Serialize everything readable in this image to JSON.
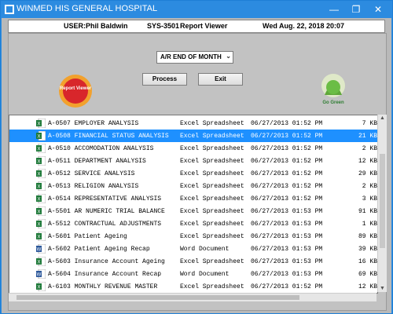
{
  "window": {
    "title": "WINMED HIS GENERAL HOSPITAL",
    "minimize": "—",
    "maximize": "❐",
    "close": "✕"
  },
  "userbar": {
    "user": "USER:Phil Baldwin",
    "system": "SYS-3501",
    "module": "Report Viewer",
    "datetime": "Wed Aug. 22, 2018 20:07"
  },
  "controls": {
    "report_select": "A/R END OF MONTH",
    "process_label": "Process",
    "exit_label": "Exit"
  },
  "logos": {
    "report_viewer": "Report Viewer",
    "go_green": "Go Green"
  },
  "files": [
    {
      "code": "A-0507",
      "name": "EMPLOYER ANALYSIS",
      "type": "Excel Spreadsheet",
      "date": "06/27/2013 01:52 PM",
      "size": "7 KB",
      "icon": "excel-icon",
      "selected": false
    },
    {
      "code": "A-0508",
      "name": "FINANCIAL STATUS ANALYSIS",
      "type": "Excel Spreadsheet",
      "date": "06/27/2013 01:52 PM",
      "size": "21 KB",
      "icon": "excel-icon",
      "selected": true
    },
    {
      "code": "A-0510",
      "name": "ACCOMODATION ANALYSIS",
      "type": "Excel Spreadsheet",
      "date": "06/27/2013 01:52 PM",
      "size": "2 KB",
      "icon": "excel-icon",
      "selected": false
    },
    {
      "code": "A-0511",
      "name": "DEPARTMENT ANALYSIS",
      "type": "Excel Spreadsheet",
      "date": "06/27/2013 01:52 PM",
      "size": "12 KB",
      "icon": "excel-icon",
      "selected": false
    },
    {
      "code": "A-0512",
      "name": "SERVICE ANALYSIS",
      "type": "Excel Spreadsheet",
      "date": "06/27/2013 01:52 PM",
      "size": "29 KB",
      "icon": "excel-icon",
      "selected": false
    },
    {
      "code": "A-0513",
      "name": "RELIGION ANALYSIS",
      "type": "Excel Spreadsheet",
      "date": "06/27/2013 01:52 PM",
      "size": "2 KB",
      "icon": "excel-icon",
      "selected": false
    },
    {
      "code": "A-0514",
      "name": "REPRESENTATIVE ANALYSIS",
      "type": "Excel Spreadsheet",
      "date": "06/27/2013 01:52 PM",
      "size": "3 KB",
      "icon": "excel-icon",
      "selected": false
    },
    {
      "code": "A-5501",
      "name": "AR NUMERIC TRIAL BALANCE",
      "type": "Excel Spreadsheet",
      "date": "06/27/2013 01:53 PM",
      "size": "91 KB",
      "icon": "excel-icon",
      "selected": false
    },
    {
      "code": "A-5512",
      "name": "CONTRACTUAL ADJUSTMENTS",
      "type": "Excel Spreadsheet",
      "date": "06/27/2013 01:53 PM",
      "size": "1 KB",
      "icon": "excel-icon",
      "selected": false
    },
    {
      "code": "A-5601",
      "name": "Patient Ageing",
      "type": "Excel Spreadsheet",
      "date": "06/27/2013 01:53 PM",
      "size": "89 KB",
      "icon": "excel-icon",
      "selected": false
    },
    {
      "code": "A-5602",
      "name": "Patient Ageing Recap",
      "type": "Word Document",
      "date": "06/27/2013 01:53 PM",
      "size": "39 KB",
      "icon": "word-icon",
      "selected": false
    },
    {
      "code": "A-5603",
      "name": "Insurance Account Ageing",
      "type": "Excel Spreadsheet",
      "date": "06/27/2013 01:53 PM",
      "size": "16 KB",
      "icon": "excel-icon",
      "selected": false
    },
    {
      "code": "A-5604",
      "name": "Insurance Account Recap",
      "type": "Word Document",
      "date": "06/27/2013 01:53 PM",
      "size": "69 KB",
      "icon": "word-icon",
      "selected": false
    },
    {
      "code": "A-6103",
      "name": "MONTHLY REVENUE MASTER",
      "type": "Excel Spreadsheet",
      "date": "06/27/2013 01:52 PM",
      "size": "12 KB",
      "icon": "excel-icon",
      "selected": false
    }
  ],
  "colors": {
    "titlebar": "#2c8be0",
    "selection": "#1e90ff",
    "excel": "#1f7a3a",
    "word": "#2b579a"
  }
}
